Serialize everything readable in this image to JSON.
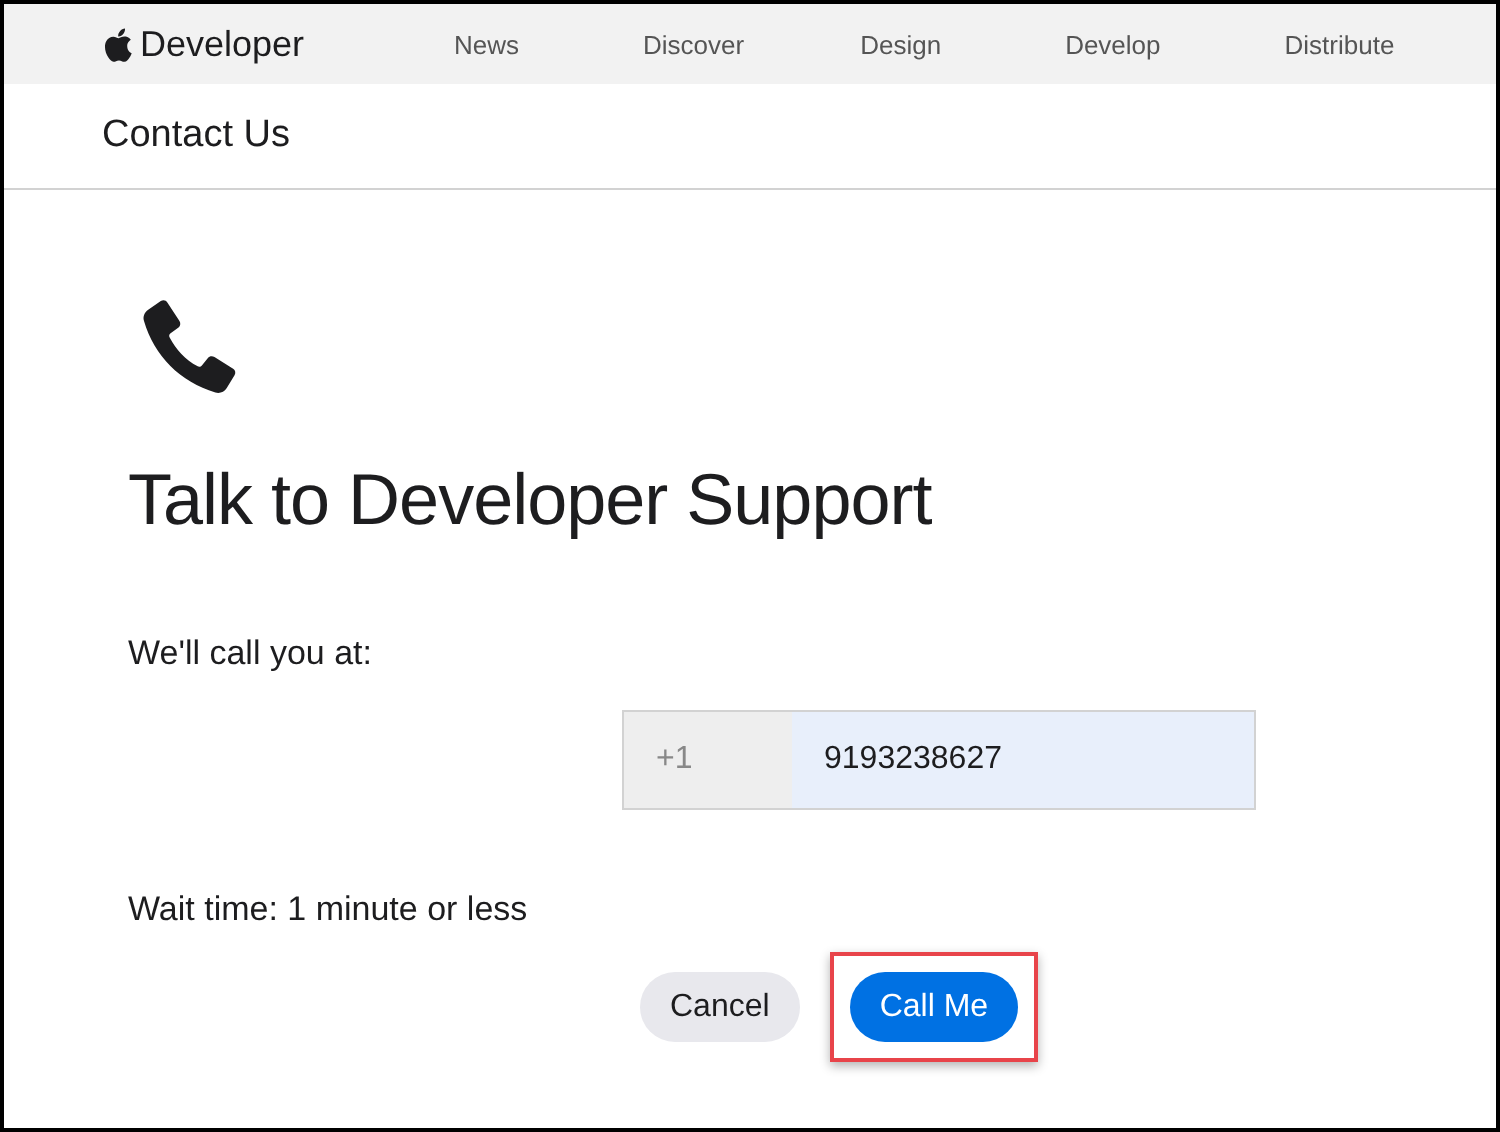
{
  "nav": {
    "brand": "Developer",
    "links": [
      "News",
      "Discover",
      "Design",
      "Develop",
      "Distribute"
    ]
  },
  "subheader": {
    "title": "Contact Us"
  },
  "main": {
    "title": "Talk to Developer Support",
    "call_label": "We'll call you at:",
    "phone": {
      "prefix": "+1",
      "value": "9193238627"
    },
    "wait_time": "Wait time: 1 minute or less",
    "buttons": [
      {
        "label": "Cancel",
        "kind": "secondary",
        "highlighted": false
      },
      {
        "label": "Call Me",
        "kind": "primary",
        "highlighted": true
      }
    ]
  }
}
